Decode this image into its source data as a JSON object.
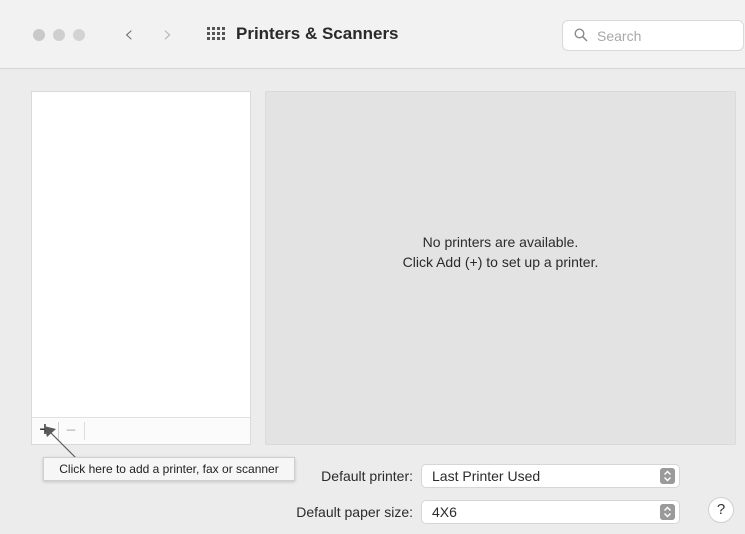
{
  "window": {
    "title": "Printers & Scanners",
    "search_placeholder": "Search"
  },
  "toolbar": {
    "back_glyph": "‹",
    "forward_glyph": "›",
    "icons": [
      "close-button",
      "minimize-button",
      "zoom-button",
      "back-icon",
      "forward-icon",
      "show-all-grid-icon",
      "search-icon"
    ]
  },
  "printer_list": {
    "add_label": "+",
    "remove_label": "−",
    "items": []
  },
  "detail": {
    "empty_line1": "No printers are available.",
    "empty_line2": "Click Add (+) to set up a printer."
  },
  "tooltip": {
    "text": "Click here to add a printer, fax or scanner"
  },
  "settings": {
    "default_printer_label": "Default printer:",
    "default_printer_value": "Last Printer Used",
    "paper_size_label": "Default paper size:",
    "paper_size_value": "4X6"
  },
  "help": {
    "label": "?"
  },
  "colors": {
    "window_bg": "#ececec",
    "detail_bg": "#e3e3e3",
    "stepper": "#9a9a9a"
  }
}
